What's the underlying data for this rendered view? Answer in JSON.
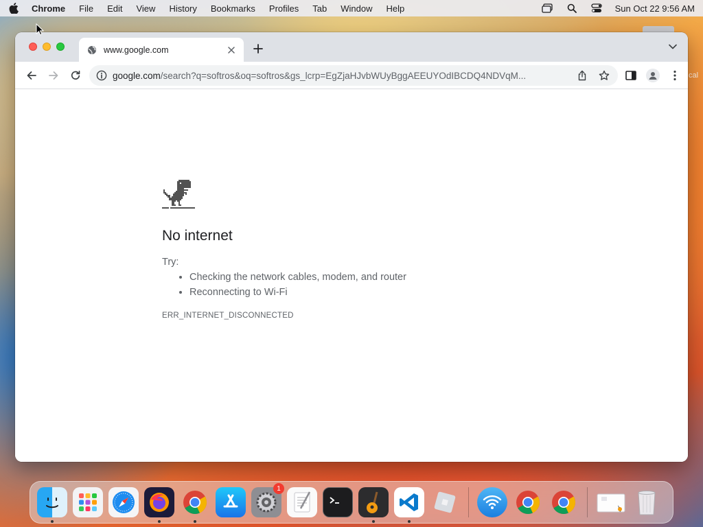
{
  "menubar": {
    "app_name": "Chrome",
    "items": [
      "File",
      "Edit",
      "View",
      "History",
      "Bookmarks",
      "Profiles",
      "Tab",
      "Window",
      "Help"
    ],
    "clock": "Sun Oct 22  9:56 AM"
  },
  "browser": {
    "tab": {
      "title": "www.google.com"
    },
    "omnibox": {
      "host": "google.com",
      "path": "/search?q=softros&oq=softros&gs_lcrp=EgZjaHJvbWUyBggAEEUYOdIBCDQ4NDVqM..."
    }
  },
  "error_page": {
    "heading": "No internet",
    "try_label": "Try:",
    "suggestions": [
      "Checking the network cables, modem, and router",
      "Reconnecting to Wi-Fi"
    ],
    "error_code": "ERR_INTERNET_DISCONNECTED"
  },
  "desktop": {
    "edge_label": "cal"
  },
  "dock": {
    "settings_badge": "1",
    "apps": [
      "finder",
      "launchpad",
      "safari",
      "firefox",
      "chrome",
      "app-store",
      "system-settings",
      "textedit",
      "terminal",
      "garageband",
      "vscode",
      "roblox",
      "wifi-utility",
      "chrome",
      "chrome",
      "documents",
      "trash"
    ]
  },
  "colors": {
    "accent_blue": "#1a73e8",
    "text_primary": "#202124",
    "text_secondary": "#5f6368"
  }
}
